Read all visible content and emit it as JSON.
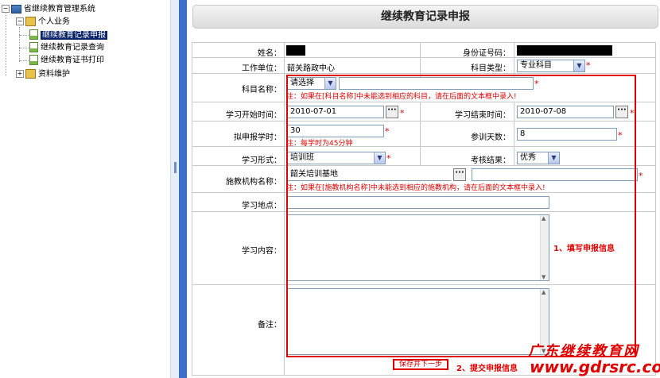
{
  "tree": {
    "root": "省继续教育管理系统",
    "group1": "个人业务",
    "items": [
      "继续教育记录申报",
      "继续教育记录查询",
      "继续教育证书打印"
    ],
    "group2": "资料维护"
  },
  "page_title": "继续教育记录申报",
  "form": {
    "name_label": "姓名：",
    "id_label": "身份证号码：",
    "workunit_label": "工作单位：",
    "workunit_value": "韶关路政中心",
    "subject_type_label": "科目类型：",
    "subject_type_value": "专业科目",
    "subject_name_label": "科目名称：",
    "subject_name_value": "请选择",
    "subject_note": "注：如果在[科目名称]中未能选到相应的科目，请在后面的文本框中录入!",
    "start_label": "学习开始时间：",
    "start_value": "2010-07-01",
    "end_label": "学习结束时间：",
    "end_value": "2010-07-08",
    "hours_label": "拟申报学时：",
    "hours_value": "30",
    "hours_note": "注：每学时为45分钟",
    "days_label": "参训天数：",
    "days_value": "8",
    "form_label": "学习形式：",
    "form_value": "培训班",
    "result_label": "考核结果：",
    "result_value": "优秀",
    "org_label": "施教机构名称：",
    "org_value": "韶关培训基地",
    "org_note": "注：如果在[施教机构名称]中未能选到相应的施教机构，请在后面的文本框中录入!",
    "place_label": "学习地点：",
    "content_label": "学习内容：",
    "remark_label": "备注：",
    "ellipsis": "···",
    "star": "*",
    "arrow": "▼"
  },
  "annotations": {
    "step1": "1、填写申报信息",
    "step2": "2、提交申报信息",
    "submit_label": "保存并下一步"
  },
  "watermark": {
    "cn": "广东继续教育网",
    "url": "www.gdrsrc.com"
  }
}
